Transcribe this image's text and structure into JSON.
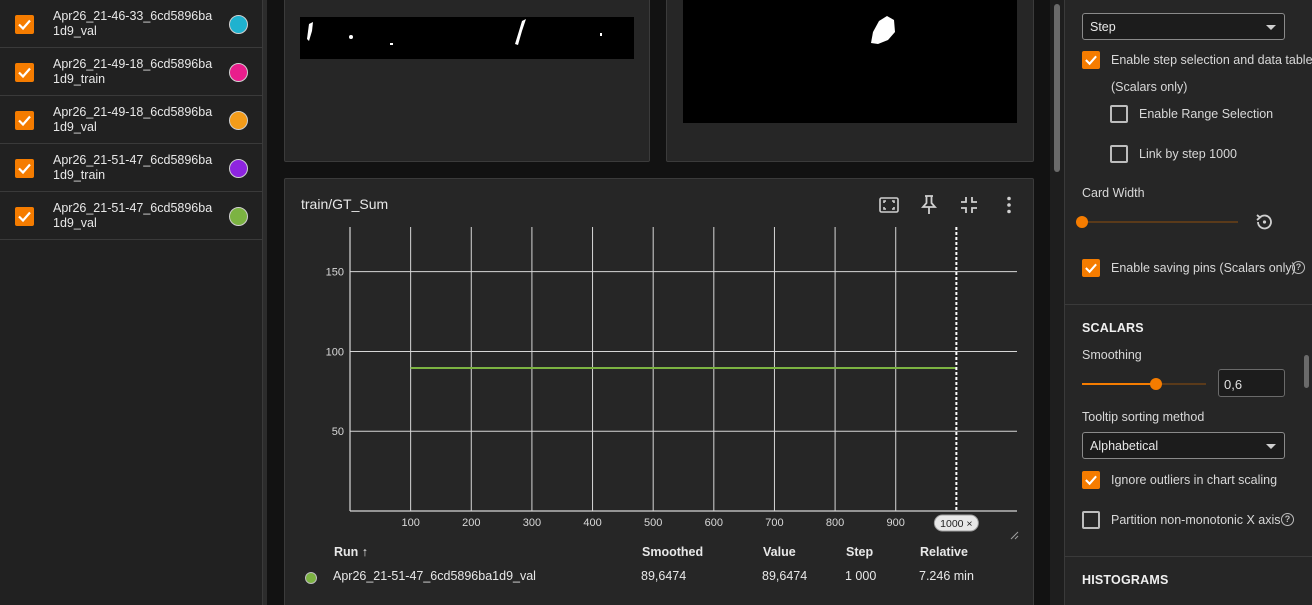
{
  "runs": [
    {
      "label": "Apr26_21-46-33_6cd5896ba1d9_val",
      "color": "#1fb2cf",
      "checked": true
    },
    {
      "label": "Apr26_21-49-18_6cd5896ba1d9_train",
      "color": "#e91e8c",
      "checked": true
    },
    {
      "label": "Apr26_21-49-18_6cd5896ba1d9_val",
      "color": "#f39c1a",
      "checked": true
    },
    {
      "label": "Apr26_21-51-47_6cd5896ba1d9_train",
      "color": "#8e24e0",
      "checked": true
    },
    {
      "label": "Apr26_21-51-47_6cd5896ba1d9_val",
      "color": "#7cb342",
      "checked": true
    }
  ],
  "scalar_card": {
    "title": "train/GT_Sum",
    "buttons": [
      "fit-domain-icon",
      "pin-icon",
      "collapse-icon",
      "more-vert-icon"
    ],
    "step_marker_label": "1000 ×",
    "table": {
      "headers": {
        "run": "Run ↑",
        "smoothed": "Smoothed",
        "value": "Value",
        "step": "Step",
        "relative": "Relative"
      },
      "row": {
        "run": "Apr26_21-51-47_6cd5896ba1d9_val",
        "smoothed": "89,6474",
        "value": "89,6474",
        "step": "1 000",
        "relative": "7.246 min",
        "color": "#7cb342"
      }
    }
  },
  "chart_data": {
    "type": "line",
    "title": "train/GT_Sum",
    "xlabel": "",
    "ylabel": "",
    "x_ticks": [
      100,
      200,
      300,
      400,
      500,
      600,
      700,
      800,
      900
    ],
    "y_ticks": [
      50,
      100,
      150
    ],
    "xlim": [
      0,
      1100
    ],
    "ylim": [
      0,
      178
    ],
    "grid": true,
    "selected_step": 1000,
    "series": [
      {
        "color": "#7cb342",
        "x": [
          100,
          1000
        ],
        "y": [
          89.6474,
          89.6474
        ]
      }
    ]
  },
  "settings": {
    "x_axis_select": "Step",
    "step_selection": {
      "label": "Enable step selection and data table",
      "sub": "(Scalars only)",
      "checked": true
    },
    "range_selection": {
      "label": "Enable Range Selection",
      "checked": false
    },
    "link_by_step": {
      "label": "Link by step 1000",
      "checked": false
    },
    "card_width": {
      "label": "Card Width",
      "value": 0
    },
    "saving_pins": {
      "label": "Enable saving pins (Scalars only)",
      "checked": true
    },
    "scalars_header": "SCALARS",
    "smoothing": {
      "label": "Smoothing",
      "value": "0,6",
      "fraction": 0.6
    },
    "tooltip_sort": {
      "label": "Tooltip sorting method",
      "value": "Alphabetical"
    },
    "ignore_outliers": {
      "label": "Ignore outliers in chart scaling",
      "checked": true
    },
    "partition": {
      "label": "Partition non-monotonic X axis",
      "checked": false
    },
    "histograms_header": "HISTOGRAMS",
    "accent_color": "#f57c00"
  }
}
